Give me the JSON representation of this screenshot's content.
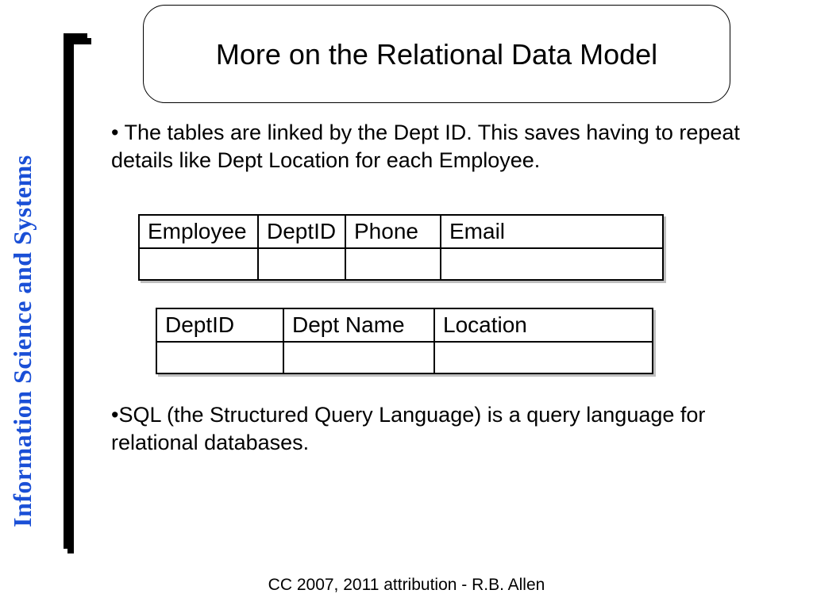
{
  "sidebar_text": "Information Science and Systems",
  "title": "More on the Relational Data Model",
  "bullet1": "• The tables are linked by the Dept ID.  This saves having to repeat details like Dept Location for each Employee.",
  "bullet2": "•SQL (the Structured Query Language)  is a query language for relational databases.",
  "table1": {
    "headers": [
      "Employee",
      "DeptID",
      "Phone",
      "Email"
    ]
  },
  "table2": {
    "headers": [
      "DeptID",
      "Dept Name",
      "Location"
    ]
  },
  "footer": "CC 2007, 2011 attribution - R.B. Allen"
}
